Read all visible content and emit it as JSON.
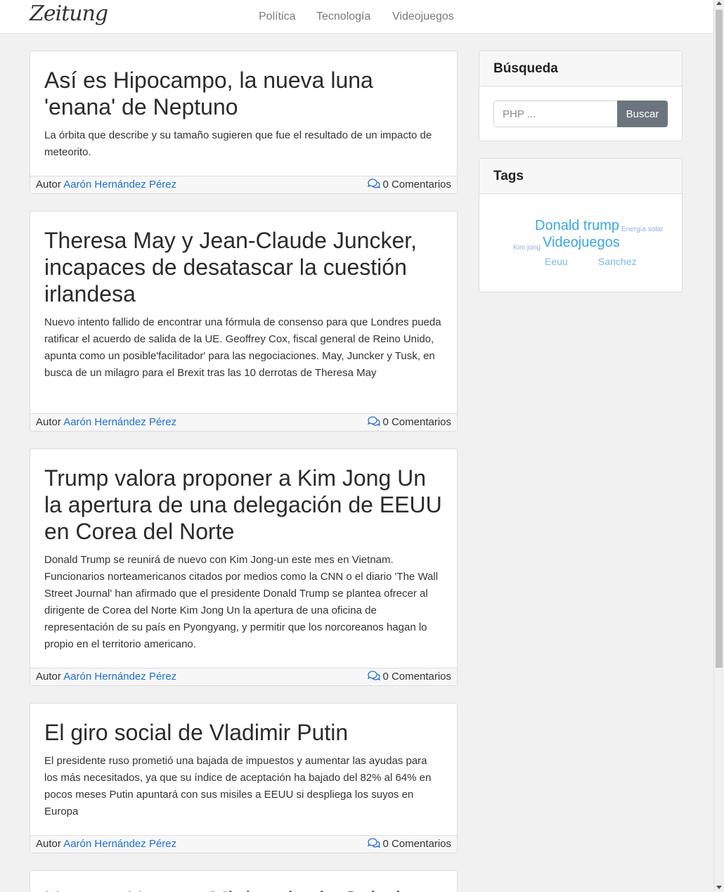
{
  "navbar": {
    "brand": "Zeitung",
    "links": [
      "Política",
      "Tecnología",
      "Videojuegos"
    ]
  },
  "posts": [
    {
      "title": "Así es Hipocampo, la nueva luna 'enana' de Neptuno",
      "excerpt": "La órbita que describe y su tamaño sugieren que fue el resultado de un impacto de meteorito.",
      "author_label": "Autor",
      "author": "Aarón Hernández Pérez",
      "comments": "0 Comentarios"
    },
    {
      "title": "Theresa May y Jean-Claude Juncker, incapaces de desatascar la cuestión irlandesa",
      "excerpt": "Nuevo intento fallido de encontrar una fórmula de consenso para que Londres pueda ratificar el acuerdo de salida de la UE. Geoffrey Cox, fiscal general de Reino Unido, apunta como un posible'facilitador' para las negociaciones. May, Juncker y Tusk, en busca de un milagro para el Brexit tras las 10 derrotas de Theresa May",
      "author_label": "Autor",
      "author": "Aarón Hernández Pérez",
      "comments": "0 Comentarios"
    },
    {
      "title": "Trump valora proponer a Kim Jong Un la apertura de una delegación de EEUU en Corea del Norte",
      "excerpt": "Donald Trump se reunirá de nuevo con Kim Jong-un este mes en Vietnam. Funcionarios norteamericanos citados por medios como la CNN o el diario 'The Wall Street Journal' han afirmado que el presidente Donald Trump se plantea ofrecer al dirigente de Corea del Norte Kim Jong Un la apertura de una oficina de representación de su país en Pyongyang, y permitir que los norcoreanos hagan lo propio en el territorio americano.",
      "author_label": "Autor",
      "author": "Aarón Hernández Pérez",
      "comments": "0 Comentarios"
    },
    {
      "title": "El giro social de Vladimir Putin",
      "excerpt": "El presidente ruso prometió una bajada de impuestos y aumentar las ayudas para los más necesitados, ya que su índice de aceptación ha bajado del 82% al 64% en pocos meses Putin apuntará con sus misiles a EEUU si despliega los suyos en Europa",
      "author_label": "Autor",
      "author": "Aarón Hernández Pérez",
      "comments": "0 Comentarios"
    },
    {
      "title": "Herrero Herrero Ministerio de Salud"
    }
  ],
  "sidebar": {
    "search": {
      "title": "Búsqueda",
      "placeholder": "PHP ...",
      "button": "Buscar"
    },
    "tags": {
      "title": "Tags",
      "items": [
        "Donald trump",
        "Energía solar",
        "Kim jong",
        "Videojuegos",
        "Eeuu",
        "Sanchez"
      ]
    }
  },
  "colors": {
    "link": "#1f6fd1",
    "tag_large": "#3aa7e8",
    "tag_small": "#8fb1e6",
    "button": "#6c757d"
  }
}
